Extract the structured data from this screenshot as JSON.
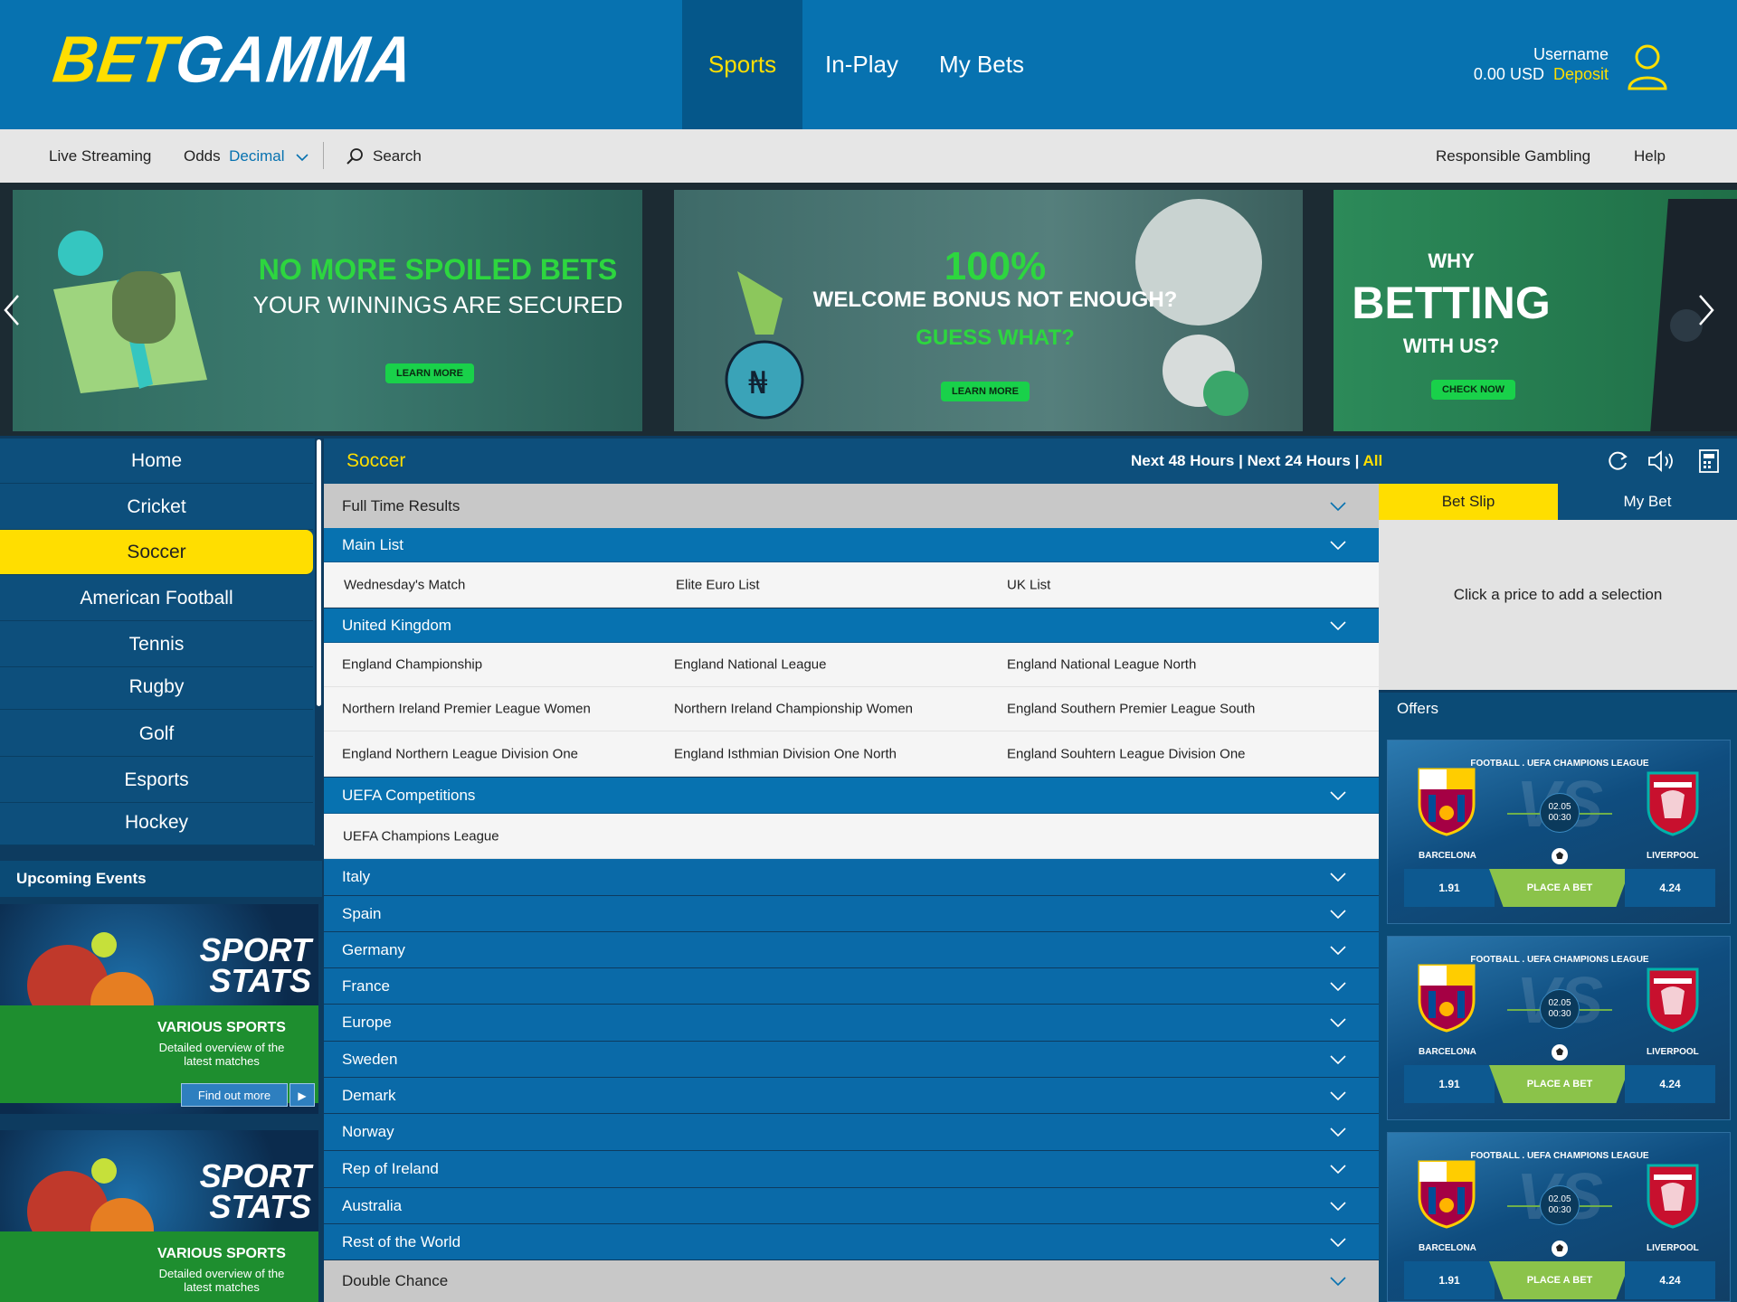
{
  "header": {
    "logo_part1": "BET",
    "logo_part2": "GAMMA",
    "nav": {
      "sports": "Sports",
      "inplay": "In-Play",
      "mybets": "My Bets"
    },
    "account": {
      "username": "Username",
      "balance": "0.00 USD",
      "deposit": "Deposit"
    }
  },
  "subbar": {
    "live_streaming": "Live Streaming",
    "odds_label": "Odds",
    "odds_value": "Decimal",
    "search": "Search",
    "responsible": "Responsible Gambling",
    "help": "Help"
  },
  "banners": [
    {
      "line1": "NO MORE SPOILED BETS",
      "line2": "YOUR WINNINGS ARE SECURED",
      "button": "LEARN MORE"
    },
    {
      "line1": "100%",
      "line2": "WELCOME BONUS NOT ENOUGH?",
      "line3": "GUESS WHAT?",
      "button": "LEARN MORE"
    },
    {
      "line1": "WHY",
      "line2": "BETTING",
      "line3": "WITH US?",
      "button": "CHECK NOW"
    }
  ],
  "sidebar": {
    "items": [
      {
        "label": "Home"
      },
      {
        "label": "Cricket"
      },
      {
        "label": "Soccer"
      },
      {
        "label": "American Football"
      },
      {
        "label": "Tennis"
      },
      {
        "label": "Rugby"
      },
      {
        "label": "Golf"
      },
      {
        "label": "Esports"
      },
      {
        "label": "Hockey"
      }
    ],
    "upcoming": "Upcoming Events",
    "promo": {
      "title1": "SPORT",
      "title2": "STATS",
      "various": "VARIOUS SPORTS",
      "desc1": "Detailed overview of the",
      "desc2": "latest matches",
      "button": "Find out more"
    }
  },
  "main": {
    "section_title": "Soccer",
    "filter": {
      "h48": "Next 48 Hours",
      "sep1": "|",
      "h24": "Next 24 Hours",
      "sep2": "|",
      "all": "All"
    },
    "full_time": "Full Time Results",
    "main_list": {
      "title": "Main List",
      "links": [
        "Wednesday's Match",
        "Elite Euro List",
        "UK List"
      ]
    },
    "uk": {
      "title": "United Kingdom",
      "links": [
        [
          "England Championship",
          "England National League",
          "England National League North"
        ],
        [
          "Northern Ireland Premier League Women",
          "Northern Ireland Championship Women",
          "England Southern Premier League South"
        ],
        [
          "England Northern League Division One",
          "England Isthmian Division One North",
          "England Souhtern League Division One"
        ]
      ]
    },
    "uefa": {
      "title": "UEFA Competitions",
      "links": [
        "UEFA Champions League"
      ]
    },
    "countries": [
      "Italy",
      "Spain",
      "Germany",
      "France",
      "Europe",
      "Sweden",
      "Demark",
      "Norway",
      "Rep of Ireland",
      "Australia",
      "Rest of the World"
    ],
    "double_chance": "Double Chance"
  },
  "betslip": {
    "tab_slip": "Bet Slip",
    "tab_mybet": "My Bet",
    "empty": "Click a price to add a selection"
  },
  "offers": {
    "title": "Offers",
    "items": [
      {
        "league": "FOOTBALL . UEFA CHAMPIONS LEAGUE",
        "date": "02.05",
        "time": "00:30",
        "home": "BARCELONA",
        "away": "LIVERPOOL",
        "odd_home": "1.91",
        "odd_away": "4.24",
        "place": "PLACE A BET",
        "vs": "VS"
      },
      {
        "league": "FOOTBALL . UEFA CHAMPIONS LEAGUE",
        "date": "02.05",
        "time": "00:30",
        "home": "BARCELONA",
        "away": "LIVERPOOL",
        "odd_home": "1.91",
        "odd_away": "4.24",
        "place": "PLACE A BET",
        "vs": "VS"
      },
      {
        "league": "FOOTBALL . UEFA CHAMPIONS LEAGUE",
        "date": "02.05",
        "time": "00:30",
        "home": "BARCELONA",
        "away": "LIVERPOOL",
        "odd_home": "1.91",
        "odd_away": "4.24",
        "place": "PLACE A BET",
        "vs": "VS"
      }
    ]
  },
  "colors": {
    "brand_blue": "#0772b0",
    "brand_yellow": "#ffde00",
    "dark_blue": "#0d4f7c",
    "promo_green": "#19d14a"
  },
  "icons": [
    "user-icon",
    "search-icon",
    "chevron-down-icon",
    "refresh-icon",
    "speaker-icon",
    "calculator-icon",
    "arrow-left-icon",
    "arrow-right-icon"
  ]
}
